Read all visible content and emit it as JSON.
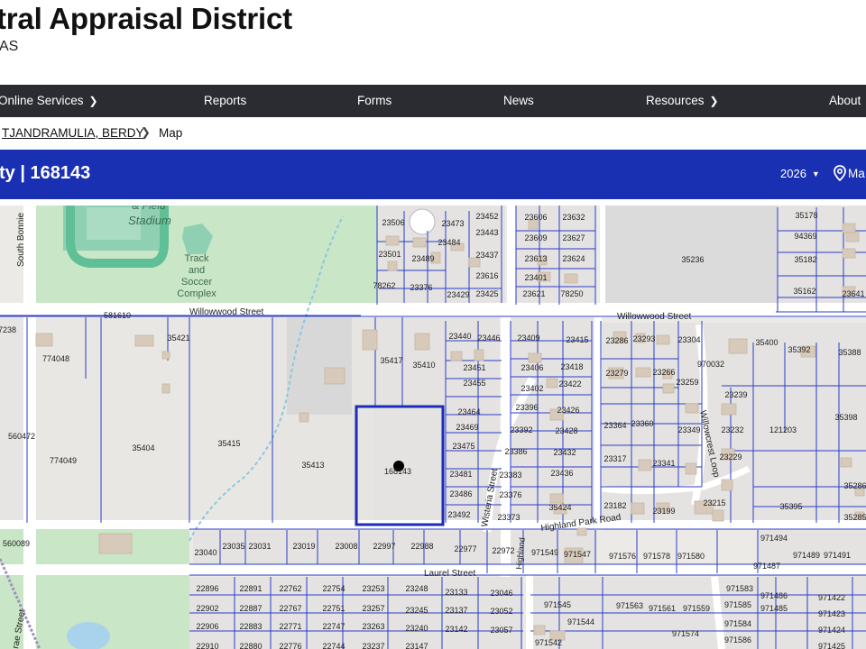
{
  "header": {
    "title": "tral Appraisal District",
    "subtitle": "AS"
  },
  "nav": {
    "online_services": "Online Services",
    "reports": "Reports",
    "forms": "Forms",
    "news": "News",
    "resources": "Resources",
    "about": "About"
  },
  "breadcrumb": {
    "owner": "TJANDRAMULIA, BERDY",
    "current": "Map"
  },
  "property_bar": {
    "title": "ty | 168143",
    "year": "2026",
    "map_label": "Ma"
  },
  "map": {
    "selected_parcel": "168143",
    "streets": {
      "willowwood_west": "Willowwood Street",
      "willowwood_east": "Willowwood Street",
      "wisteria": "Wisteria Street",
      "highland_park": "Highland Park Road",
      "laurel": "Laurel Street",
      "willowcrest": "Willowcrest Loop",
      "south_bonnie": "South Bonnie",
      "street_sw": "rae Street"
    },
    "landmarks": {
      "stadium_partial": "& Field",
      "stadium": "Stadium",
      "track1": "Track",
      "track2": "and",
      "track3": "Soccer",
      "track4": "Complex"
    },
    "parcel_labels": [
      "23506",
      "23473",
      "23452",
      "23606",
      "23632",
      "35178",
      "23501",
      "23484",
      "23443",
      "23609",
      "23627",
      "94369",
      "23489",
      "23437",
      "23613",
      "23624",
      "35182",
      "35236",
      "78262",
      "23376",
      "23429",
      "23616",
      "23401",
      "23425",
      "23621",
      "78250",
      "35162",
      "23641",
      "581610",
      "7238",
      "23440",
      "23446",
      "23409",
      "23415",
      "23286",
      "23293",
      "23304",
      "35400",
      "35392",
      "35388",
      "774048",
      "35421",
      "35417",
      "35410",
      "23451",
      "23406",
      "23418",
      "23279",
      "23266",
      "970032",
      "23455",
      "23422",
      "23259",
      "23402",
      "23239",
      "23396",
      "23426",
      "23464",
      "23364",
      "23360",
      "23349",
      "23232",
      "121203",
      "35398",
      "23392",
      "23469",
      "23428",
      "560472",
      "35404",
      "35415",
      "23386",
      "23475",
      "23432",
      "23229",
      "774049",
      "35413",
      "168143",
      "23317",
      "23341",
      "23383",
      "23481",
      "23436",
      "35286",
      "23376",
      "23486",
      "35424",
      "23215",
      "23182",
      "23199",
      "35395",
      "23373",
      "23492",
      "35285",
      "971494",
      "560089",
      "23040",
      "23035",
      "23031",
      "23019",
      "23008",
      "22997",
      "22988",
      "22977",
      "22972",
      "971549",
      "971547",
      "971576",
      "971578",
      "971580",
      "971489",
      "971491",
      "971487",
      "22896",
      "22891",
      "22762",
      "22754",
      "23253",
      "23248",
      "23133",
      "23046",
      "971583",
      "971486",
      "971422",
      "22902",
      "22887",
      "22767",
      "22751",
      "23257",
      "23245",
      "23137",
      "23052",
      "971545",
      "971563",
      "971561",
      "971559",
      "971585",
      "971485",
      "971423",
      "22906",
      "22883",
      "22771",
      "22747",
      "23263",
      "23240",
      "23142",
      "23057",
      "971544",
      "971584",
      "971424",
      "22910",
      "22880",
      "22776",
      "22744",
      "23237",
      "23147",
      "971542",
      "971574",
      "971586",
      "971425"
    ]
  }
}
